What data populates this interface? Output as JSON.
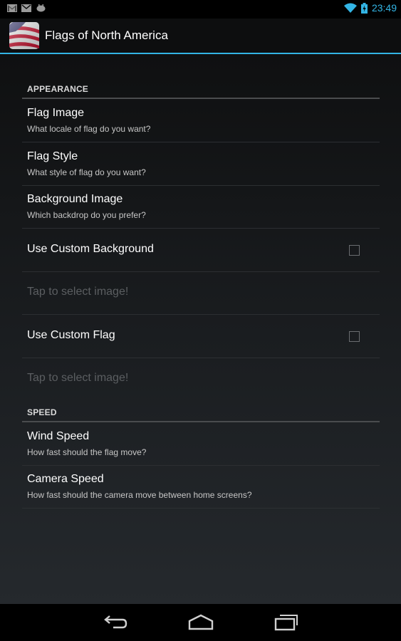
{
  "status_bar": {
    "time": "23:49",
    "left_icons": [
      "gmail-icon",
      "email-icon",
      "android-debug-icon"
    ],
    "right_icons": [
      "wifi-icon",
      "battery-charging-icon"
    ],
    "accent_color": "#33b5e5"
  },
  "action_bar": {
    "title": "Flags of North America",
    "icon": "us-flag-app-icon"
  },
  "sections": {
    "appearance": {
      "header": "APPEARANCE",
      "flag_image": {
        "title": "Flag Image",
        "summary": "What locale of flag do you want?"
      },
      "flag_style": {
        "title": "Flag Style",
        "summary": "What style of flag do you want?"
      },
      "background_image": {
        "title": "Background Image",
        "summary": "Which backdrop do you prefer?"
      },
      "use_custom_background": {
        "title": "Use Custom Background",
        "checked": false
      },
      "select_background_image": {
        "title": "Tap to select image!",
        "enabled": false
      },
      "use_custom_flag": {
        "title": "Use Custom Flag",
        "checked": false
      },
      "select_flag_image": {
        "title": "Tap to select image!",
        "enabled": false
      }
    },
    "speed": {
      "header": "SPEED",
      "wind_speed": {
        "title": "Wind Speed",
        "summary": "How fast should the flag move?"
      },
      "camera_speed": {
        "title": "Camera Speed",
        "summary": "How fast should the camera move between home screens?"
      }
    }
  },
  "nav_bar": {
    "buttons": [
      "back-icon",
      "home-icon",
      "recent-apps-icon"
    ]
  }
}
